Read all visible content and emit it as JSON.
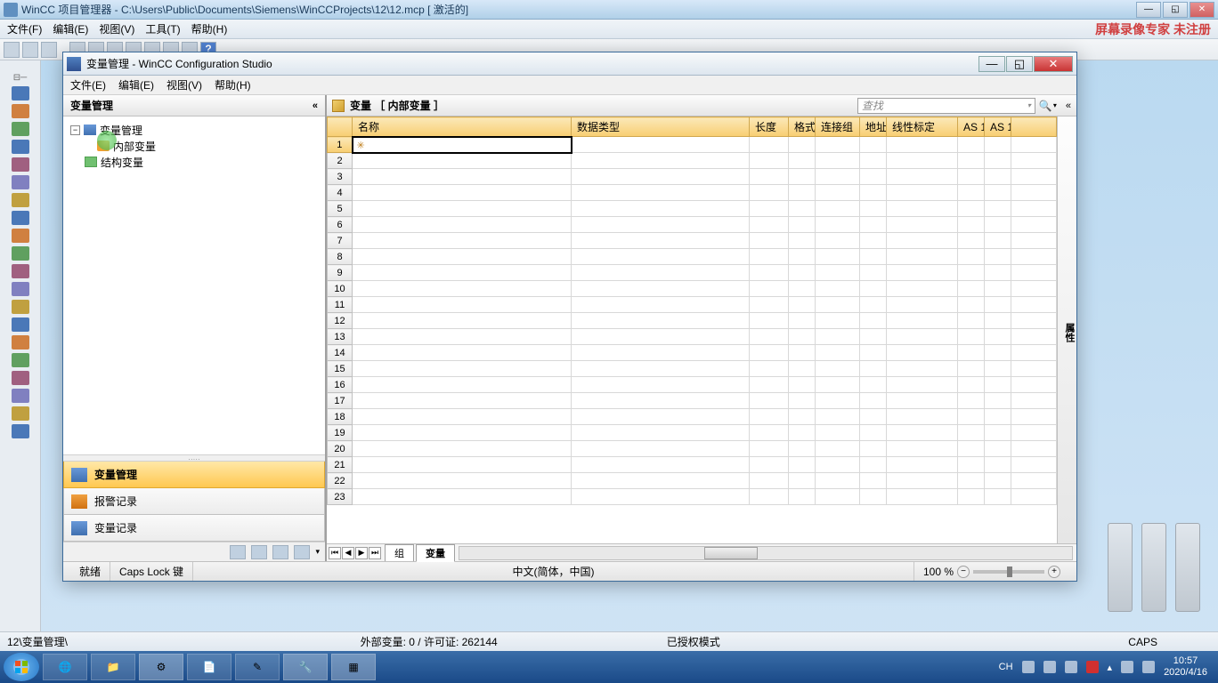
{
  "parent": {
    "title": "WinCC 项目管理器 - C:\\Users\\Public\\Documents\\Siemens\\WinCCProjects\\12\\12.mcp [ 激活的]",
    "menu": {
      "file": "文件(F)",
      "edit": "编辑(E)",
      "view": "视图(V)",
      "tools": "工具(T)",
      "help": "帮助(H)"
    },
    "watermark": "屏幕录像专家 未注册",
    "status_path": "12\\变量管理\\",
    "status_license": "外部变量: 0 / 许可证: 262144",
    "status_mode": "已授权模式",
    "status_caps": "CAPS"
  },
  "child": {
    "title": "变量管理 - WinCC Configuration Studio",
    "menu": {
      "file": "文件(E)",
      "edit": "编辑(E)",
      "view": "视图(V)",
      "help": "帮助(H)"
    },
    "left_header": "变量管理",
    "tree": {
      "root": "变量管理",
      "internal": "内部变量",
      "struct": "结构变量"
    },
    "nav": {
      "tag_mgmt": "变量管理",
      "alarm": "报警记录",
      "tag_log": "变量记录"
    },
    "right_title": "变量 ［ 内部变量 ］",
    "search_placeholder": "查找",
    "prop_label": "属性",
    "columns": {
      "name": "名称",
      "datatype": "数据类型",
      "length": "长度",
      "format": "格式",
      "conn": "连接组",
      "addr": "地址",
      "linear": "线性标定",
      "as1": "AS 1",
      "as2": "AS 1"
    },
    "sheets": {
      "group": "组",
      "tag": "变量"
    },
    "status": {
      "ready": "就绪",
      "caps": "Caps Lock 键",
      "lang": "中文(简体，中国)",
      "zoom": "100 %"
    }
  },
  "taskbar": {
    "ime": "CH",
    "time": "10:57",
    "date": "2020/4/16"
  }
}
